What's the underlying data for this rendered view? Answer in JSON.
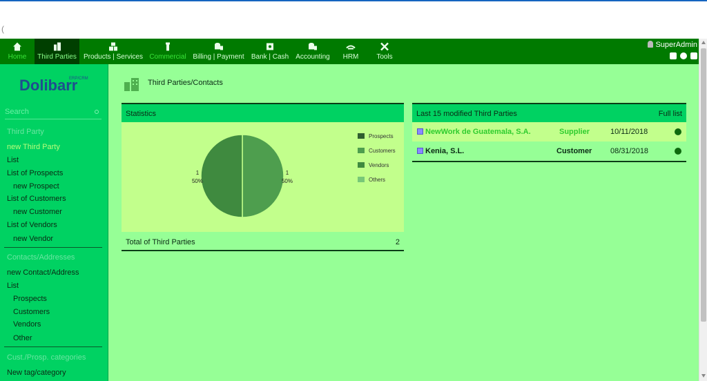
{
  "topnav": {
    "items": [
      {
        "label": "Home",
        "icon": "home-icon"
      },
      {
        "label": "Third Parties",
        "icon": "building-icon"
      },
      {
        "label": "Products | Services",
        "icon": "cubes-icon"
      },
      {
        "label": "Commercial",
        "icon": "suitcase-icon"
      },
      {
        "label": "Billing | Payment",
        "icon": "coins-icon"
      },
      {
        "label": "Bank | Cash",
        "icon": "safe-icon"
      },
      {
        "label": "Accounting",
        "icon": "coins-icon"
      },
      {
        "label": "HRM",
        "icon": "person-icon"
      },
      {
        "label": "Tools",
        "icon": "tools-icon"
      }
    ],
    "user": "SuperAdmin"
  },
  "sidebar": {
    "logo_text": "Dolibarr",
    "logo_sub": "ERP/CRM",
    "search_placeholder": "Search",
    "section1": "Third Party",
    "s1_items": [
      "new Third Party",
      "List",
      "List of Prospects",
      "new Prospect",
      "List of Customers",
      "new Customer",
      "List of Vendors",
      "new Vendor"
    ],
    "section2": "Contacts/Addresses",
    "s2_items": [
      "new Contact/Address",
      "List",
      "Prospects",
      "Customers",
      "Vendors",
      "Other"
    ],
    "section3": "Cust./Prosp. categories",
    "s3_items": [
      "New tag/category"
    ]
  },
  "page": {
    "title": "Third Parties/Contacts"
  },
  "stats": {
    "header": "Statistics",
    "total_label": "Total of Third Parties",
    "total_value": "2"
  },
  "chart_data": {
    "type": "pie",
    "categories": [
      "Prospects",
      "Customers",
      "Vendors",
      "Others"
    ],
    "values": [
      1,
      1,
      0,
      0
    ],
    "data_labels": [
      {
        "count": "1",
        "percent": "50%"
      },
      {
        "count": "1",
        "percent": "50%"
      }
    ],
    "colors": [
      "#4e9e4e",
      "#3f8a3f",
      "#4f9a4f",
      "#78c878"
    ],
    "legend": "right"
  },
  "lastmod": {
    "header": "Last 15 modified Third Parties",
    "full_list": "Full list",
    "rows": [
      {
        "name": "NewWork de Guatemala, S.A.",
        "type": "Supplier",
        "date": "10/11/2018"
      },
      {
        "name": "Kenia, S.L.",
        "type": "Customer",
        "date": "08/31/2018"
      }
    ]
  },
  "colors": {
    "topnav": "#007a00",
    "sidebar": "#00d262",
    "main_bg": "#96ff96",
    "chart_bg": "#c2ff8c",
    "link_green": "#2ecc2e",
    "status_dot": "#0e6a0e"
  }
}
